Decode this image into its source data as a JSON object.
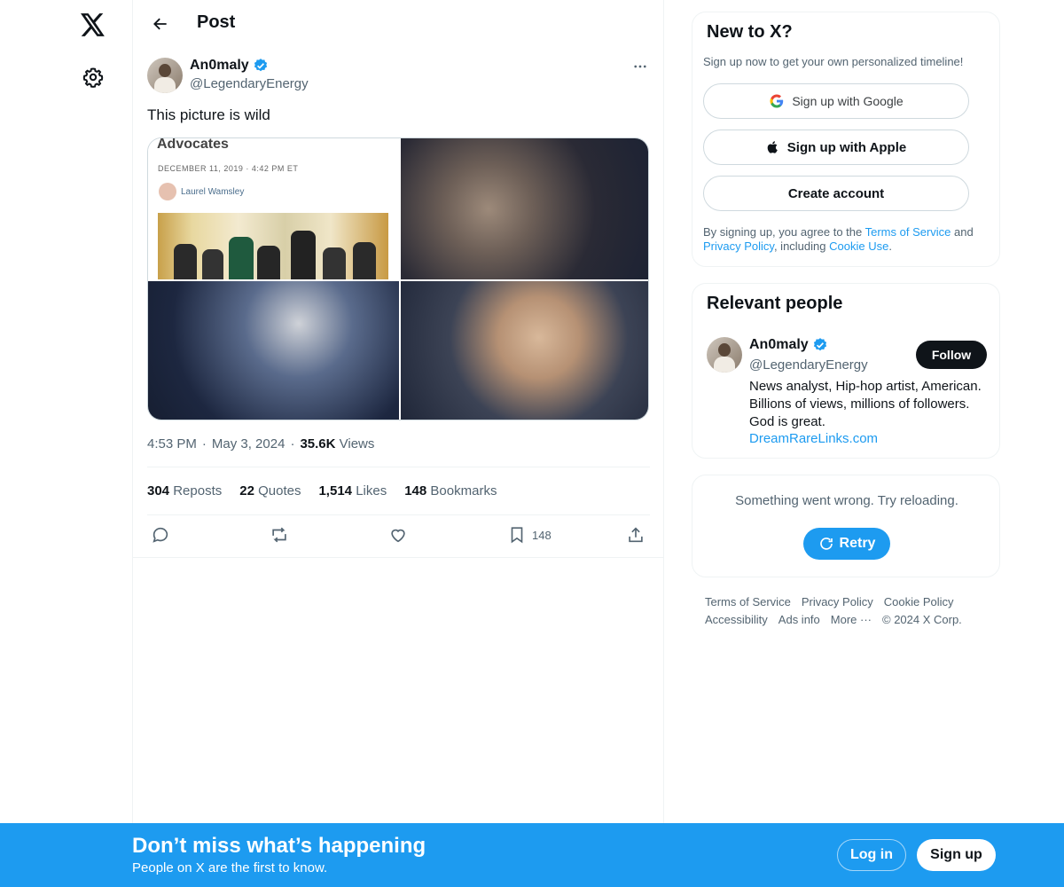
{
  "nav": {
    "logo_icon": "x-logo-icon",
    "settings_icon": "gear-icon"
  },
  "header": {
    "title": "Post",
    "back_icon": "arrow-left-icon"
  },
  "post": {
    "author_name": "An0maly",
    "author_handle": "@LegendaryEnergy",
    "text": "This picture is wild",
    "article": {
      "title": "Advocates",
      "date": "DECEMBER 11, 2019 · 4:42 PM ET",
      "author": "Laurel Wamsley"
    },
    "time": "4:53 PM",
    "date": "May 3, 2024",
    "views_count": "35.6K",
    "views_label": "Views",
    "reposts_count": "304",
    "reposts_label": "Reposts",
    "quotes_count": "22",
    "quotes_label": "Quotes",
    "likes_count": "1,514",
    "likes_label": "Likes",
    "bookmarks_count": "148",
    "bookmarks_label": "Bookmarks",
    "bookmark_action_count": "148"
  },
  "signup_card": {
    "title": "New to X?",
    "subtitle": "Sign up now to get your own personalized timeline!",
    "google_label": "Sign up with Google",
    "apple_label": "Sign up with Apple",
    "create_label": "Create account",
    "terms_prefix": "By signing up, you agree to the ",
    "terms_link": "Terms of Service",
    "terms_and": " and ",
    "privacy_link": "Privacy Policy",
    "terms_including": ", including ",
    "cookie_link": "Cookie Use",
    "terms_end": "."
  },
  "relevant_people": {
    "title": "Relevant people",
    "name": "An0maly",
    "handle": "@LegendaryEnergy",
    "follow_label": "Follow",
    "bio": "News analyst, Hip-hop artist, American. Billions of views, millions of followers. God is great.",
    "link": "DreamRareLinks.com"
  },
  "error_card": {
    "message": "Something went wrong. Try reloading.",
    "retry_label": "Retry"
  },
  "footer": {
    "terms": "Terms of Service",
    "privacy": "Privacy Policy",
    "cookie": "Cookie Policy",
    "accessibility": "Accessibility",
    "ads": "Ads info",
    "more": "More ···",
    "copyright": "© 2024 X Corp."
  },
  "banner": {
    "title": "Don’t miss what’s happening",
    "subtitle": "People on X are the first to know.",
    "login_label": "Log in",
    "signup_label": "Sign up"
  },
  "colors": {
    "accent": "#1d9bf0",
    "text": "#0f1419",
    "muted": "#536471"
  }
}
